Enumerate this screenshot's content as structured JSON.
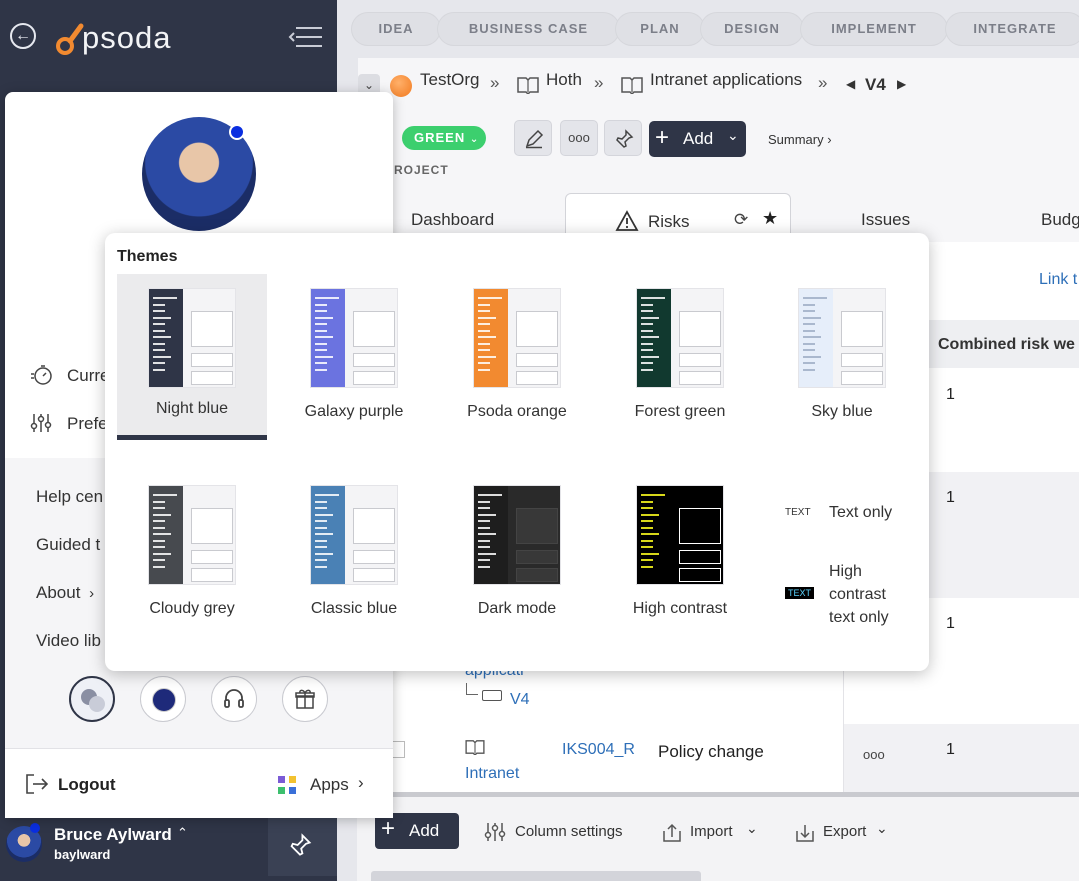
{
  "brand": {
    "logo_text": "psoda"
  },
  "stages": [
    "IDEA",
    "BUSINESS CASE",
    "PLAN",
    "DESIGN",
    "IMPLEMENT",
    "INTEGRATE"
  ],
  "breadcrumb": {
    "items": [
      "TestOrg",
      "Hoth",
      "Intranet applications"
    ],
    "version": "V4"
  },
  "toolbar": {
    "status": "GREEN",
    "add_label": "Add",
    "summary_label": "Summary ›",
    "more_label": "ooo"
  },
  "section_label": "ROJECT",
  "tabs": [
    "Dashboard",
    "Risks",
    "Issues",
    "Budg"
  ],
  "table": {
    "header_link": "Link t",
    "column_header": "Combined risk we",
    "values": [
      "1",
      "1",
      "1",
      "1"
    ],
    "rows_partial": {
      "applic_text": "applicati",
      "version_text": "V4",
      "last_row": {
        "doc_text": "Intranet",
        "id": "IKS004_R",
        "title": "Policy change",
        "more": "ooo"
      }
    }
  },
  "bottom_toolbar": {
    "add": "Add",
    "column_settings": "Column settings",
    "import": "Import",
    "export": "Export"
  },
  "profile_menu": {
    "items": [
      "Curre",
      "Prefe"
    ],
    "help_items": [
      "Help cen",
      "Guided t",
      "About",
      "Video lib"
    ],
    "logout": "Logout",
    "apps": "Apps"
  },
  "user": {
    "name": "Bruce Aylward",
    "username": "baylward"
  },
  "themes": {
    "title": "Themes",
    "items": [
      {
        "label": "Night blue",
        "color": "#2f3547",
        "selected": true
      },
      {
        "label": "Galaxy purple",
        "color": "#6b73e0",
        "selected": false
      },
      {
        "label": "Psoda orange",
        "color": "#f28a30",
        "selected": false
      },
      {
        "label": "Forest green",
        "color": "#11392f",
        "selected": false
      },
      {
        "label": "Sky blue",
        "color": "#e6eefa",
        "selected": false
      },
      {
        "label": "Cloudy grey",
        "color": "#474a4f",
        "selected": false
      },
      {
        "label": "Classic blue",
        "color": "#4a81b5",
        "selected": false
      },
      {
        "label": "Dark mode",
        "color": "#1e1e1e",
        "selected": false
      },
      {
        "label": "High contrast",
        "color": "#000000",
        "selected": false
      }
    ],
    "text_only": {
      "badge": "TEXT",
      "label": "Text only"
    },
    "high_contrast_text": {
      "badge": "TEXT",
      "label_line1": "High",
      "label_line2": "contrast",
      "label_line3": "text only"
    }
  },
  "colors": {
    "sidebar": "#2f3547",
    "status_green": "#3ccf6e",
    "accent_orange": "#f28a30",
    "link_blue": "#2e6fb8"
  }
}
